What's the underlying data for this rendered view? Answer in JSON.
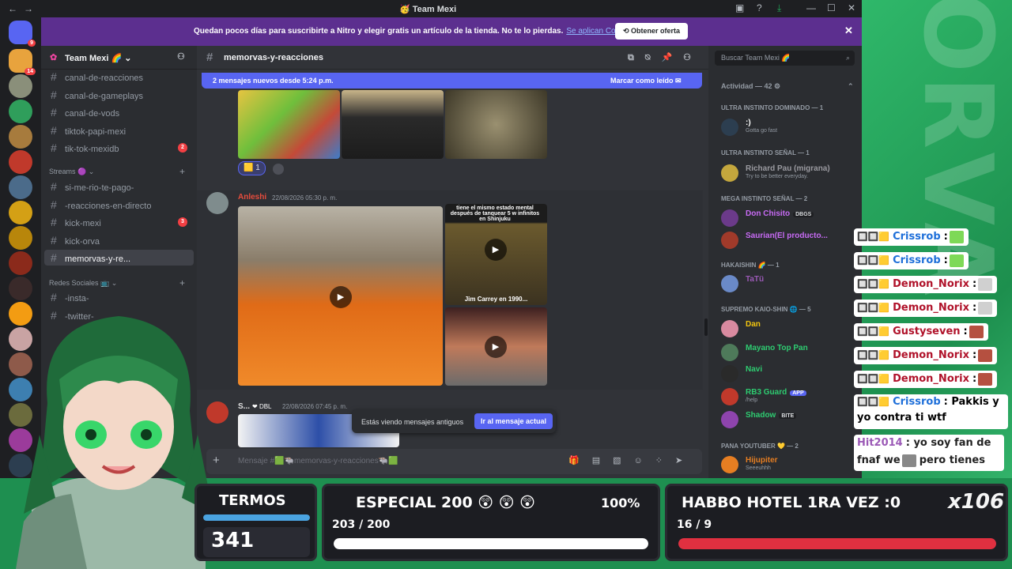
{
  "window": {
    "title": "Team Mexi"
  },
  "banner": {
    "text": "Quedan pocos días para suscribirte a Nitro y elegir gratis un artículo de la tienda. No te lo pierdas.",
    "link": "Se aplican Condiciones.",
    "button": "Obtener oferta"
  },
  "servers": {
    "badge1": "14",
    "badge2": "9"
  },
  "sidebar": {
    "server_name": "Team Mexi",
    "channels_top": [
      {
        "name": "canal-de-reacciones"
      },
      {
        "name": "canal-de-gameplays"
      },
      {
        "name": "canal-de-vods"
      },
      {
        "name": "tiktok-papi-mexi"
      },
      {
        "name": "tik-tok-mexidb",
        "count": "2"
      }
    ],
    "category_streams": "Streams",
    "channels_streams": [
      {
        "name": "si-me-rio-te-pago-"
      },
      {
        "name": "-reacciones-en-directo"
      },
      {
        "name": "kick-mexi",
        "count": "3"
      },
      {
        "name": "kick-orva"
      },
      {
        "name": "memorvas-y-re..."
      }
    ],
    "category_social": "Redes Sociales",
    "channels_social": [
      {
        "name": "-insta-"
      },
      {
        "name": "-twitter-"
      }
    ]
  },
  "chat": {
    "channel_name": "memorvas-y-reacciones",
    "new_messages": "2 mensajes nuevos desde 5:24 p.m.",
    "mark_read": "Marcar como leído",
    "reaction_count": "1",
    "msg1": {
      "author": "Anleshi",
      "time": "22/08/2026 05:30 p. m."
    },
    "video_caption_top": "tiene el mismo estado mental después de tanquear 5 w infinitos en Shinjuku",
    "video_caption_mid": "Jim Carrey en 1990...",
    "msg2": {
      "author": "S...",
      "tag": "DBL",
      "time": "22/08/2026 07:45 p. m."
    },
    "old_messages_text": "Estás viendo mensajes antiguos",
    "old_messages_button": "Ir al mensaje actual",
    "composer_placeholder": "Mensaje #🟩🐃memorvas-y-reacciones🐃🟩"
  },
  "members": {
    "search_placeholder": "Buscar Team Mexi",
    "activity": "Actividad — 42",
    "groups": [
      {
        "title": "ULTRA INSTINTO DOMINADO — 1"
      },
      {
        "title": "ULTRA INSTINTO SEÑAL — 1"
      },
      {
        "title": "MEGA INSTINTO SEÑAL — 2"
      },
      {
        "title": "HAKAISHIN 🌈 — 1"
      },
      {
        "title": "SUPREMO KAIO-SHIN 🌐 — 5"
      },
      {
        "title": "PANA YOUTUBER 💛 — 2"
      }
    ],
    "list": [
      {
        "name": ":)",
        "status": "Gotta go fast",
        "color": "#ffffff"
      },
      {
        "name": "Richard Pau (migrana)",
        "status": "Try to be better everyday.",
        "color": "#9a9aa0"
      },
      {
        "name": "Don Chisito",
        "tag": "DBGS",
        "color": "#c86bf5"
      },
      {
        "name": "Saurian(El producto...",
        "color": "#c86bf5"
      },
      {
        "name": "TaTü",
        "color": "#9b59b6"
      },
      {
        "name": "Dan",
        "color": "#f1c40f"
      },
      {
        "name": "Mayano Top Pan",
        "color": "#2ecc71"
      },
      {
        "name": "Navi",
        "color": "#2ecc71"
      },
      {
        "name": "RB3 Guard",
        "tag": "APP",
        "status": "/help",
        "color": "#2ecc71"
      },
      {
        "name": "Shadow",
        "tag": "BITE",
        "color": "#2ecc71"
      },
      {
        "name": "Hijupiter",
        "status": "Seeeuhhh",
        "color": "#e67e22"
      }
    ]
  },
  "overlay_chat": [
    {
      "user": "Crissrob",
      "text": ":"
    },
    {
      "user": "Crissrob",
      "text": ":"
    },
    {
      "user": "Demon_Norix",
      "text": ":"
    },
    {
      "user": "Demon_Norix",
      "text": ":"
    },
    {
      "user": "Gustyseven",
      "text": ":"
    },
    {
      "user": "Demon_Norix",
      "text": ":"
    },
    {
      "user": "Demon_Norix",
      "text": ":"
    },
    {
      "user": "Crissrob",
      "text": ": Pakkis y yo contra ti wtf"
    },
    {
      "user": "Hit2014",
      "text": ": yo soy fan de fnaf we",
      "text2": "pero tienes"
    }
  ],
  "widgets": {
    "termos": {
      "title": "TERMOS",
      "value": "341",
      "progress": 1.0
    },
    "especial": {
      "title": "ESPECIAL 200",
      "percent": "100%",
      "count": "203 / 200",
      "progress": 1.0
    },
    "habbo": {
      "title": "HABBO HOTEL 1RA VEZ :0",
      "count": "16 / 9",
      "multiplier": "x106",
      "progress": 1.0
    }
  },
  "colors": {
    "accent": "#5865f2",
    "nitro": "#5c2f8f",
    "stream_green": "#1e8f50"
  }
}
